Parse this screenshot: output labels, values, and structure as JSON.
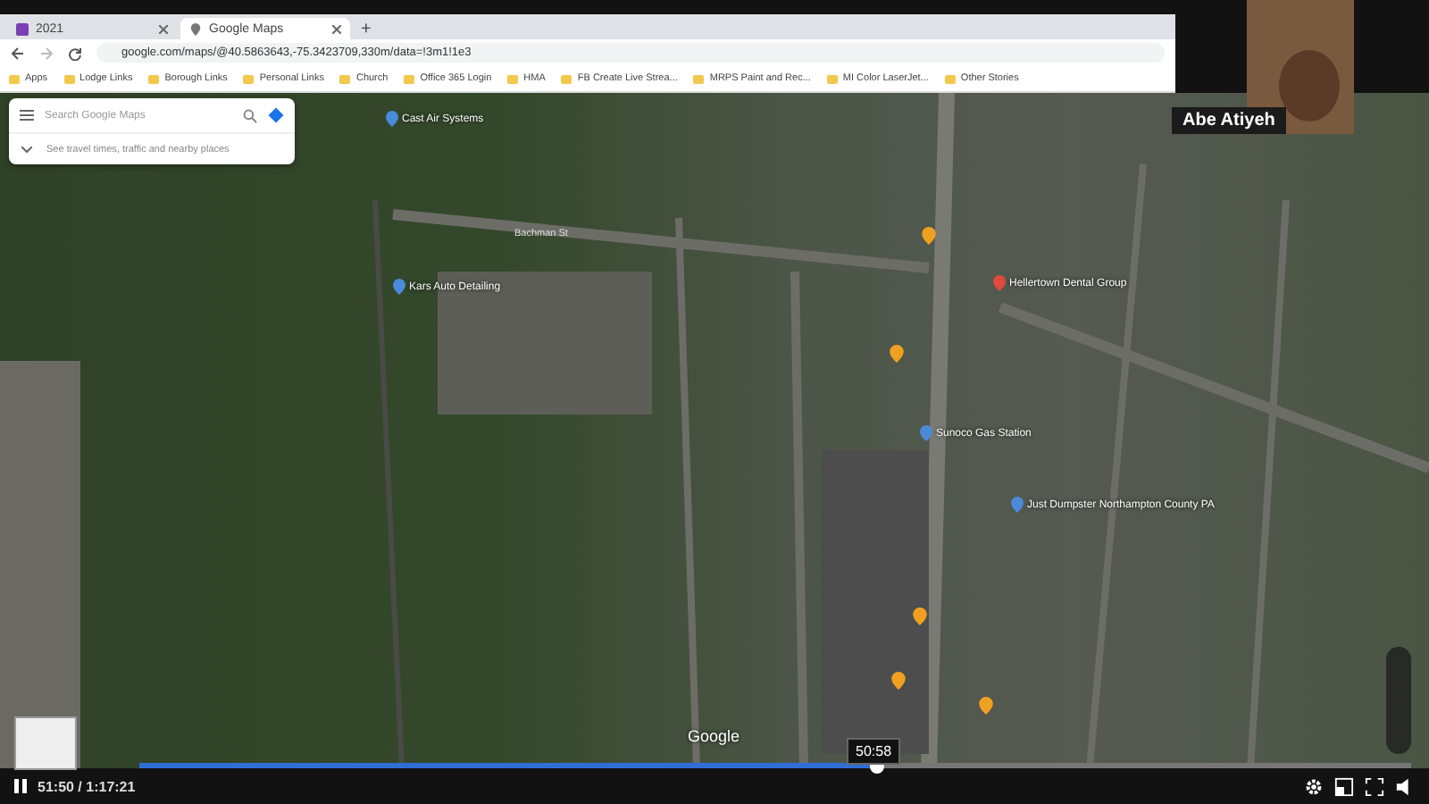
{
  "browser": {
    "tabs": [
      {
        "title": "2021",
        "selected": false
      },
      {
        "title": "Google Maps",
        "selected": true
      }
    ],
    "new_tab": "+",
    "address": "google.com/maps/@40.5863643,-75.3423709,330m/data=!3m1!1e3",
    "bookmarks": [
      "Apps",
      "Lodge Links",
      "Borough Links",
      "Personal Links",
      "Church",
      "Office 365 Login",
      "HMA",
      "FB Create Live Strea...",
      "MRPS Paint and Rec...",
      "MI Color LaserJet...",
      "Other Stories"
    ]
  },
  "maps": {
    "search": {
      "placeholder": "Search Google Maps"
    },
    "travel_hint": "See travel times, traffic and nearby places",
    "places": [
      {
        "label": "Cast Air Systems",
        "kind": "pin",
        "color": "#4a8ad8"
      },
      {
        "label": "Bachman St",
        "kind": "street"
      },
      {
        "label": "Kars Auto Detailing",
        "kind": "pin",
        "color": "#4a8ad8"
      },
      {
        "label": "Hellertown Dental Group",
        "kind": "pin",
        "color": "#e04a3c"
      },
      {
        "label": "Sunoco Gas Station",
        "kind": "pin",
        "color": "#4a8ad8"
      },
      {
        "label": "Just Dumpster Northampton County PA",
        "kind": "pin",
        "color": "#4a8ad8"
      }
    ],
    "attribution": "Google"
  },
  "participant": {
    "name": "Abe Atiyeh"
  },
  "player": {
    "time": "51:50 / 1:17:21",
    "level": 0.58,
    "preview_time": "50:58"
  }
}
